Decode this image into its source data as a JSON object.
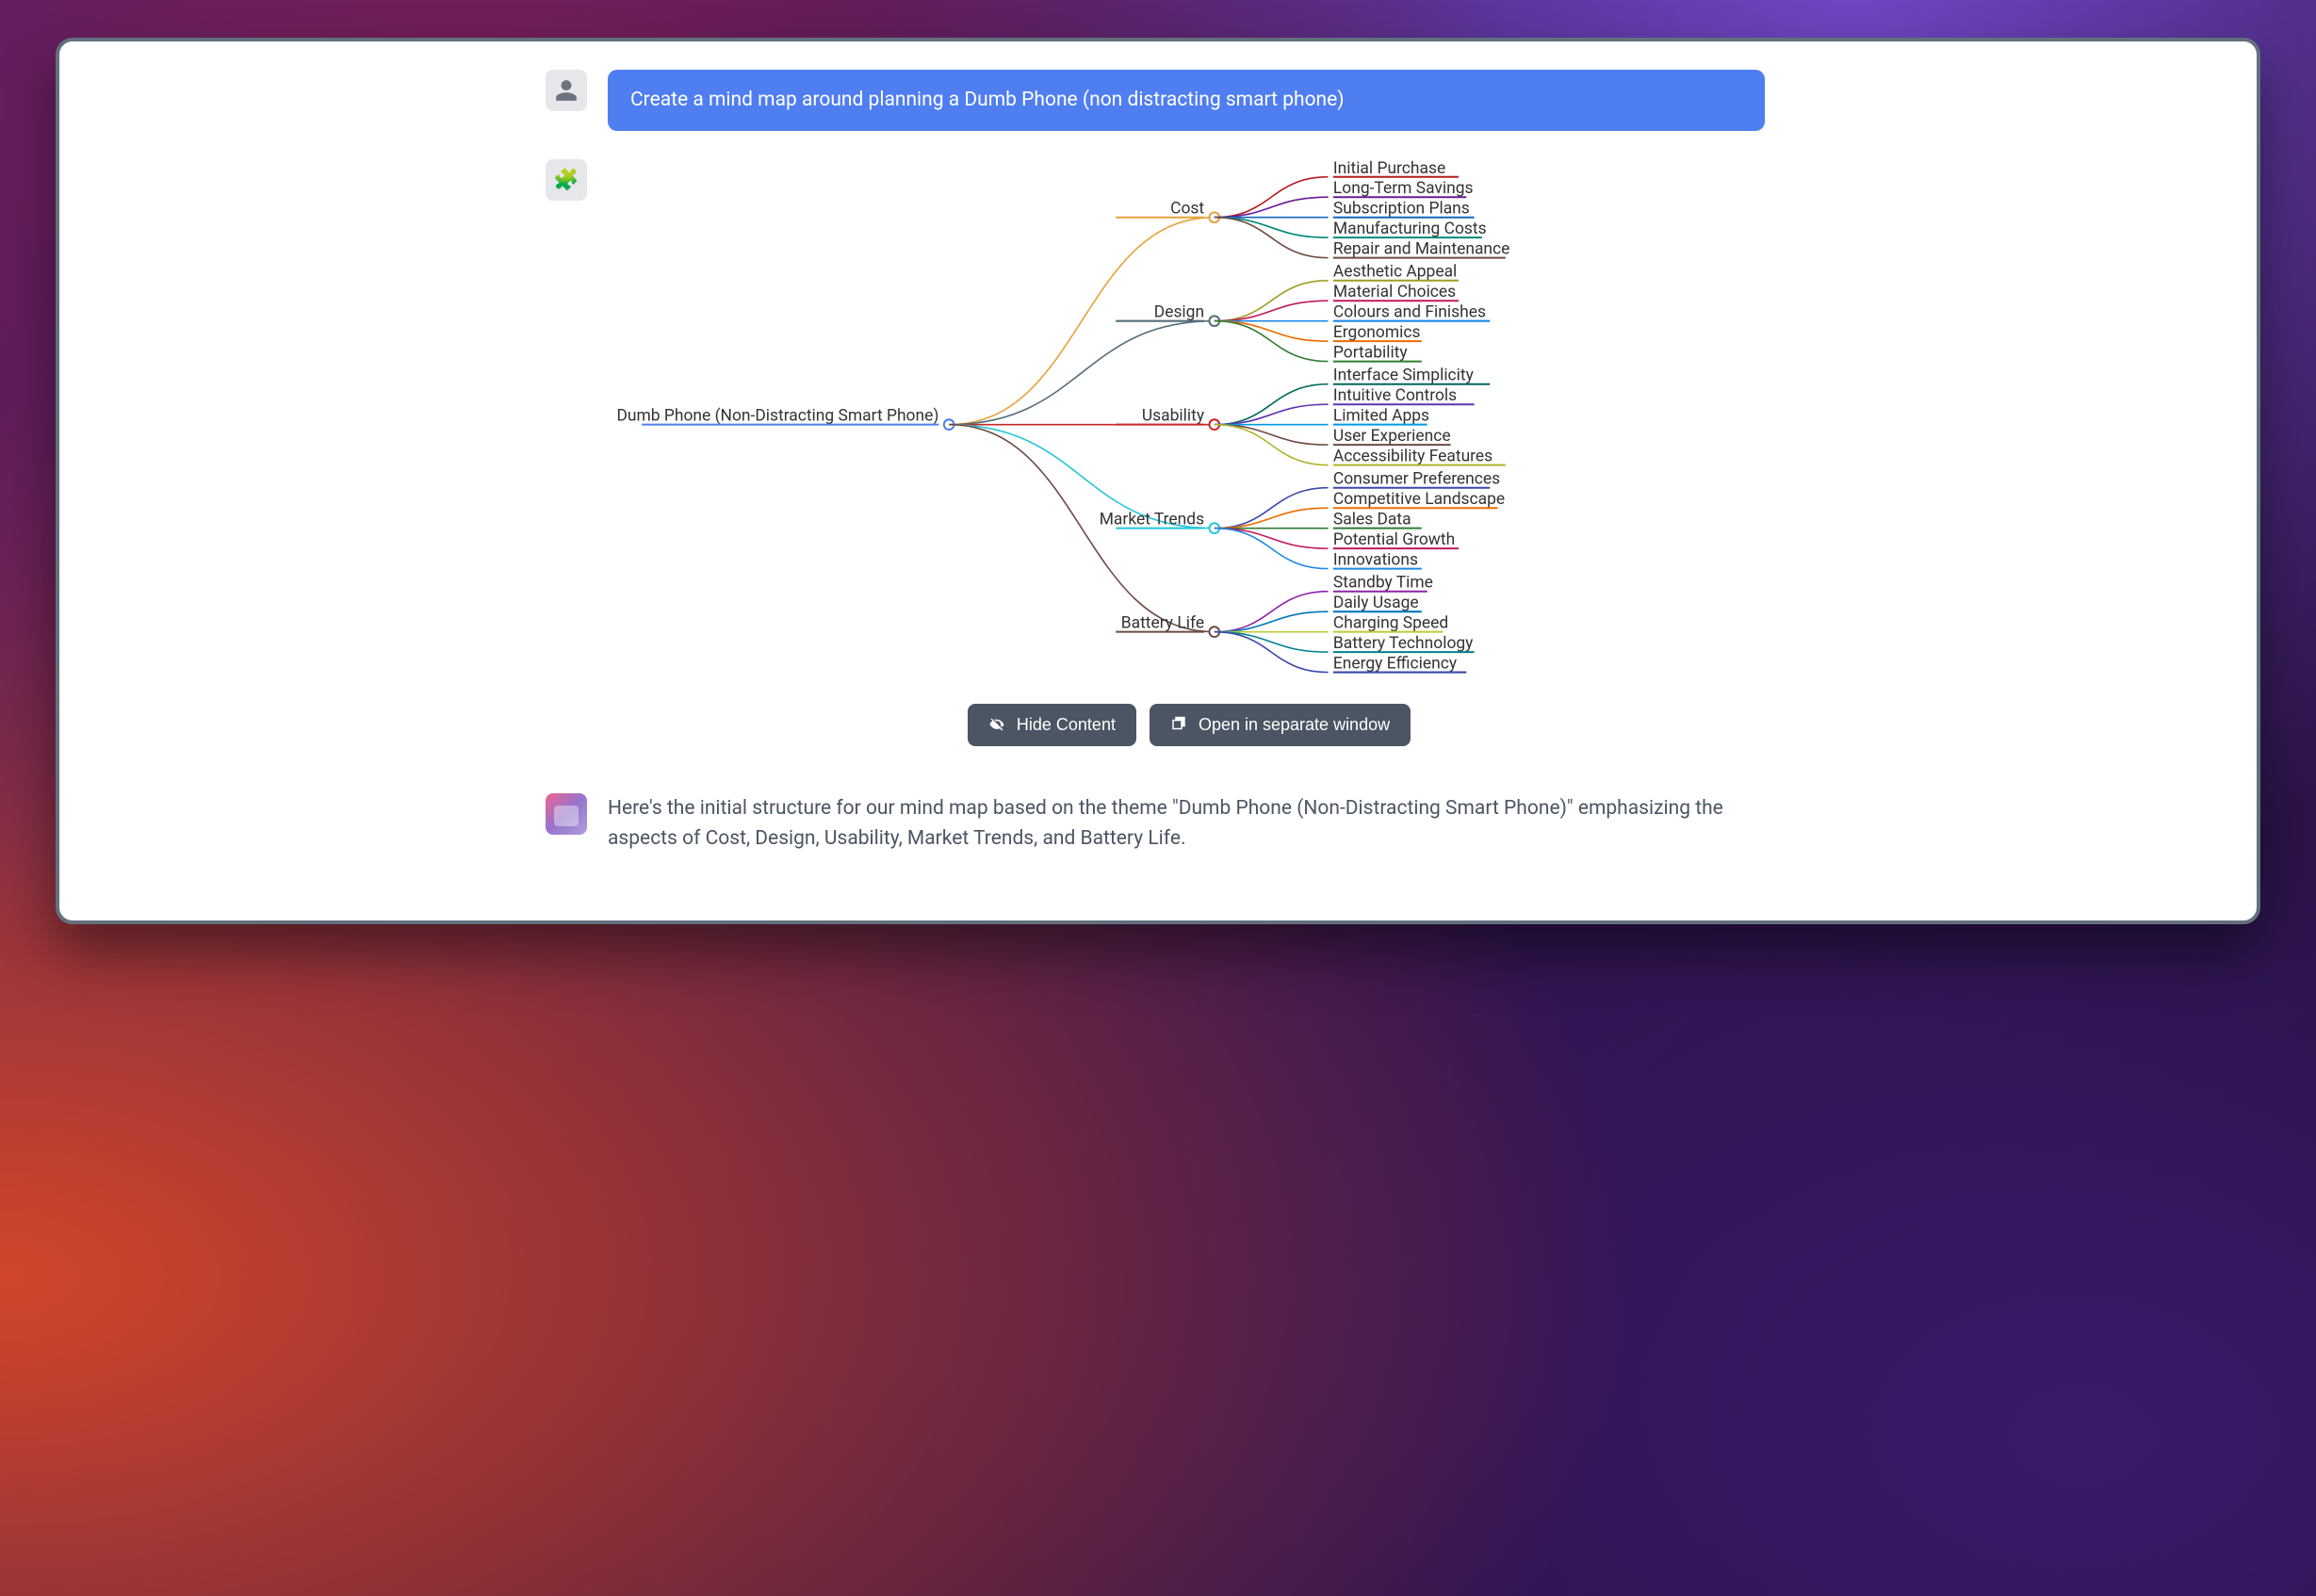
{
  "user_message": "Create a mind map around planning a Dumb Phone (non distracting smart phone)",
  "assistant_response": "Here's the initial structure for our mind map based on the theme \"Dumb Phone (Non-Distracting Smart Phone)\" emphasizing the aspects of Cost, Design, Usability, Market Trends, and Battery Life.",
  "buttons": {
    "hide": "Hide Content",
    "open": "Open in separate window"
  },
  "mindmap": {
    "root": "Dumb Phone (Non-Distracting Smart Phone)",
    "branches": [
      {
        "label": "Cost",
        "color": "#e8a13a",
        "children": [
          {
            "t": "Initial Purchase",
            "c": "#b71c1c"
          },
          {
            "t": "Long-Term Savings",
            "c": "#6a1b9a"
          },
          {
            "t": "Subscription Plans",
            "c": "#1565c0"
          },
          {
            "t": "Manufacturing Costs",
            "c": "#00897b"
          },
          {
            "t": "Repair and Maintenance",
            "c": "#6d4c41"
          }
        ]
      },
      {
        "label": "Design",
        "color": "#546e7a",
        "children": [
          {
            "t": "Aesthetic Appeal",
            "c": "#9e9d24"
          },
          {
            "t": "Material Choices",
            "c": "#c2185b"
          },
          {
            "t": "Colours and Finishes",
            "c": "#1e88e5"
          },
          {
            "t": "Ergonomics",
            "c": "#ef6c00"
          },
          {
            "t": "Portability",
            "c": "#2e7d32"
          }
        ]
      },
      {
        "label": "Usability",
        "color": "#c62828",
        "children": [
          {
            "t": "Interface Simplicity",
            "c": "#00695c"
          },
          {
            "t": "Intuitive Controls",
            "c": "#5e35b1"
          },
          {
            "t": "Limited Apps",
            "c": "#039be5"
          },
          {
            "t": "User Experience",
            "c": "#6d4c41"
          },
          {
            "t": "Accessibility Features",
            "c": "#afb42b"
          }
        ]
      },
      {
        "label": "Market Trends",
        "color": "#26c6da",
        "children": [
          {
            "t": "Consumer Preferences",
            "c": "#3949ab"
          },
          {
            "t": "Competitive Landscape",
            "c": "#ef6c00"
          },
          {
            "t": "Sales Data",
            "c": "#2e7d32"
          },
          {
            "t": "Potential Growth",
            "c": "#c2185b"
          },
          {
            "t": "Innovations",
            "c": "#1e88e5"
          }
        ]
      },
      {
        "label": "Battery Life",
        "color": "#6d4c41",
        "children": [
          {
            "t": "Standby Time",
            "c": "#8e24aa"
          },
          {
            "t": "Daily Usage",
            "c": "#0277bd"
          },
          {
            "t": "Charging Speed",
            "c": "#c0ca33"
          },
          {
            "t": "Battery Technology",
            "c": "#00838f"
          },
          {
            "t": "Energy Efficiency",
            "c": "#3949ab"
          }
        ]
      }
    ]
  }
}
